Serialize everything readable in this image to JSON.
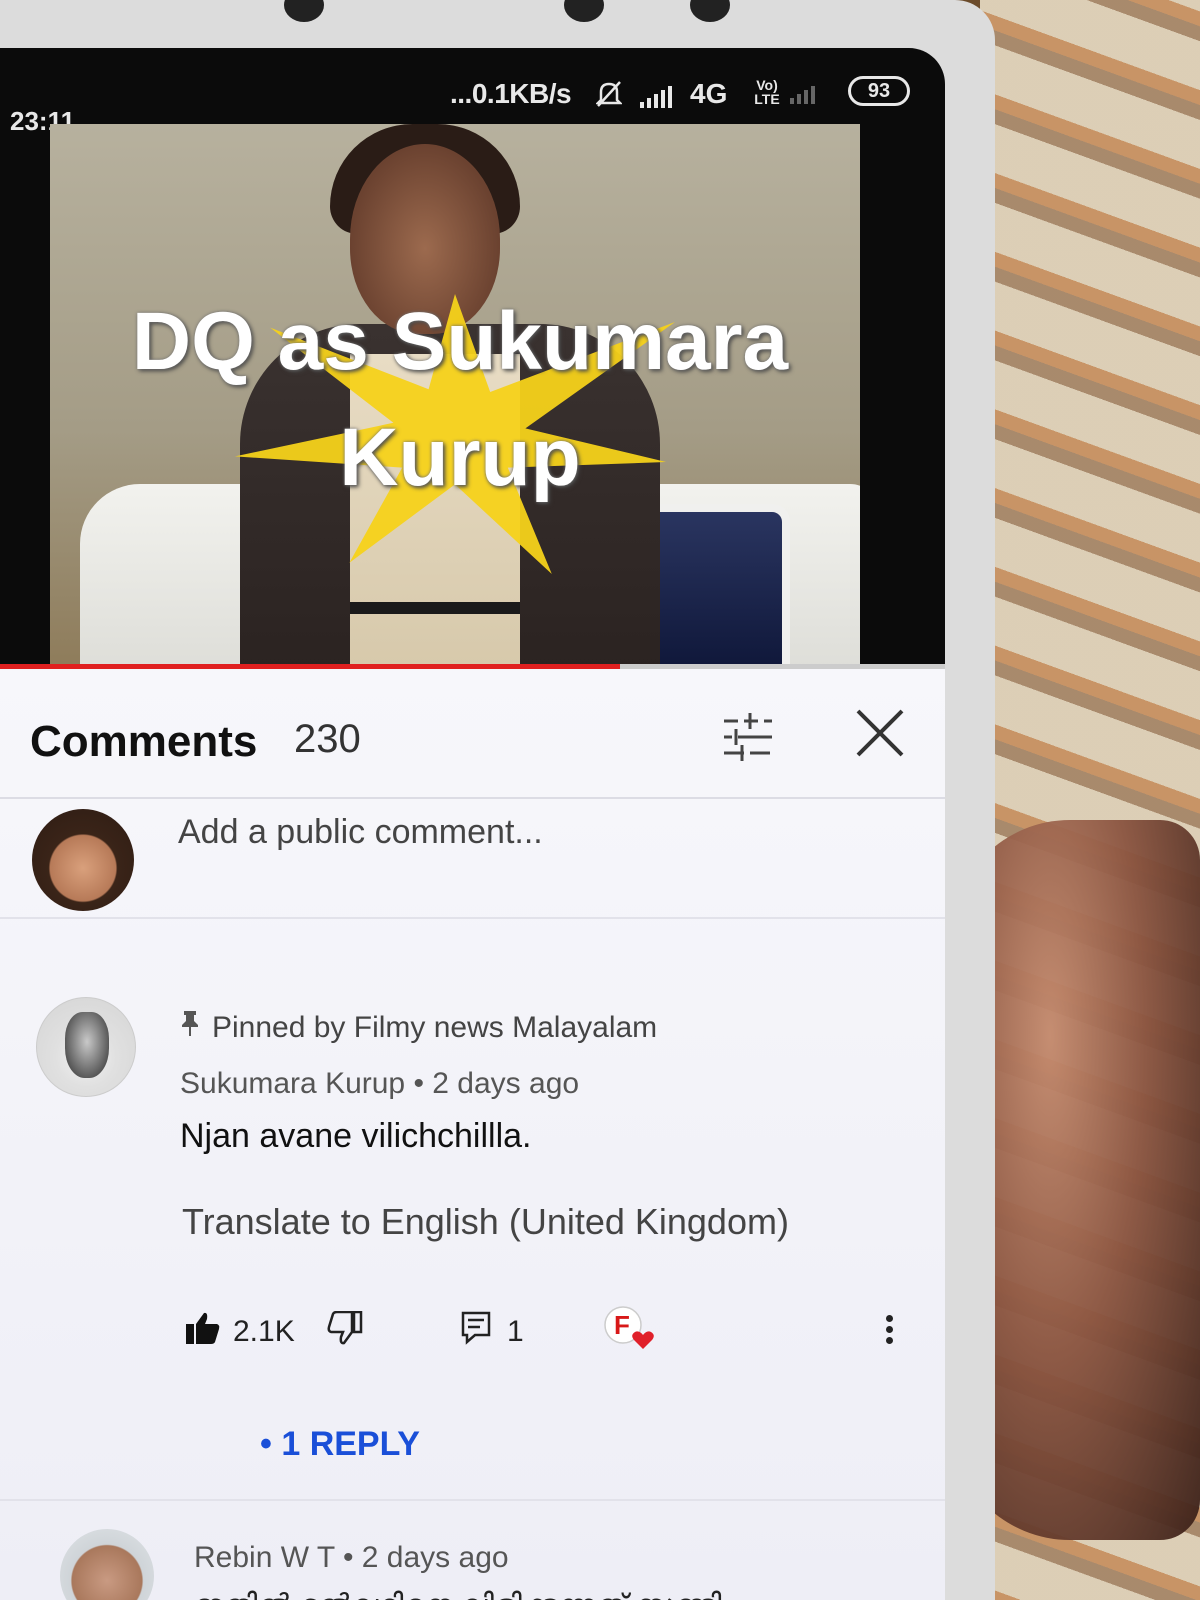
{
  "status_bar": {
    "time": "23:11",
    "network_speed": "...0.1KB/s",
    "network_type": "4G",
    "volte_label": "Vo) LTE",
    "battery": "93"
  },
  "video": {
    "title": "DQ as Sukumara\nKurup",
    "progress_fraction": 0.66
  },
  "comments_panel": {
    "title": "Comments",
    "count": "230",
    "add_comment_placeholder": "Add a public comment..."
  },
  "pinned_comment": {
    "pinned_label": "Pinned by Filmy news Malayalam",
    "author_line": "Sukumara Kurup • 2 days ago",
    "text": "Njan avane vilichchillla.",
    "translate_link": "Translate to English (United Kingdom)",
    "like_count": "2.1K",
    "reply_count": "1",
    "view_replies": "• 1 REPLY",
    "creator_badge": "F"
  },
  "second_comment": {
    "author_line": "Rebin W T • 2 days ago",
    "text": "ഇതിൽ ദുൽഖറിനെ വിളിക്കുന്നത് സുണ്ടി"
  },
  "colors": {
    "accent_red": "#e02020",
    "link_blue": "#1a4fd8",
    "like_filled": "#111111",
    "heart_red": "#e0202a"
  }
}
